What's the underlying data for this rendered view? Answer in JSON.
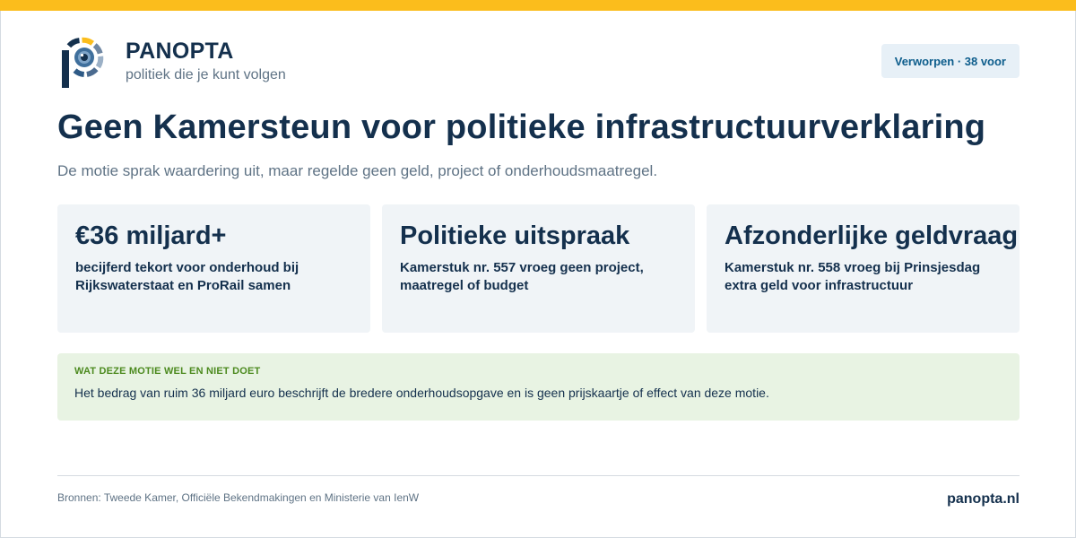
{
  "brand": {
    "name": "PANOPTA",
    "tagline": "politiek die je kunt volgen",
    "accent_color": "#fbbd1c",
    "logo_icon": "eye-p-logo-icon"
  },
  "status_badge": "Verworpen · 38 voor",
  "title": "Geen Kamersteun voor politieke infrastructuurverklaring",
  "subtitle": "De motie sprak waardering uit, maar regelde geen geld, project of onderhoudsmaatregel.",
  "cards": [
    {
      "title": "€36 miljard+",
      "text": "becijferd tekort voor onderhoud bij Rijkswaterstaat en ProRail samen"
    },
    {
      "title": "Politieke uitspraak",
      "text": "Kamerstuk nr. 557 vroeg geen project, maatregel of budget"
    },
    {
      "title": "Afzonderlijke geldvraag",
      "text": "Kamerstuk nr. 558 vroeg bij Prinsjesdag extra geld voor infrastructuur"
    }
  ],
  "note": {
    "heading": "WAT DEZE MOTIE WEL EN NIET DOET",
    "text": "Het bedrag van ruim 36 miljard euro beschrijft de bredere onderhoudsopgave en is geen prijskaartje of effect van deze motie."
  },
  "footer": {
    "sources": "Bronnen: Tweede Kamer, Officiële Bekendmakingen en Ministerie van IenW",
    "site": "panopta.nl"
  }
}
